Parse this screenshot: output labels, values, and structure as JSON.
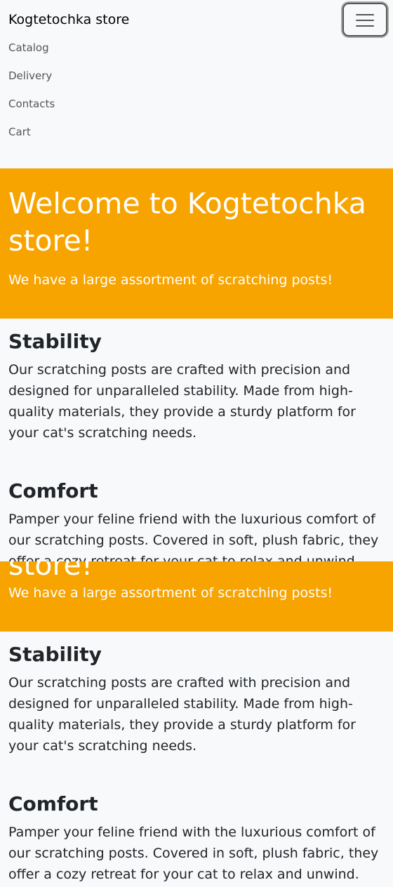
{
  "navbar": {
    "brand": "Kogtetochka store",
    "menu_icon": "hamburger-menu-icon",
    "links": [
      "Catalog",
      "Delivery",
      "Contacts",
      "Cart"
    ]
  },
  "hero": {
    "title": "Welcome to Kogtetochka store!",
    "lead": "We have a large assortment of scratching posts!",
    "ghost_text": "store!"
  },
  "features": {
    "stability": {
      "title": "Stability",
      "text": "Our scratching posts are crafted with precision and designed for unparalleled stability. Made from high-quality materials, they provide a sturdy platform for your cat's scratching needs."
    },
    "comfort": {
      "title": "Comfort",
      "text": "Pamper your feline friend with the luxurious comfort of our scratching posts. Covered in soft, plush fabric, they offer a cozy retreat for your cat to relax and unwind."
    }
  },
  "colors": {
    "hero_background": "#f7a401",
    "page_background": "#f8f9fa",
    "text": "#212529"
  }
}
